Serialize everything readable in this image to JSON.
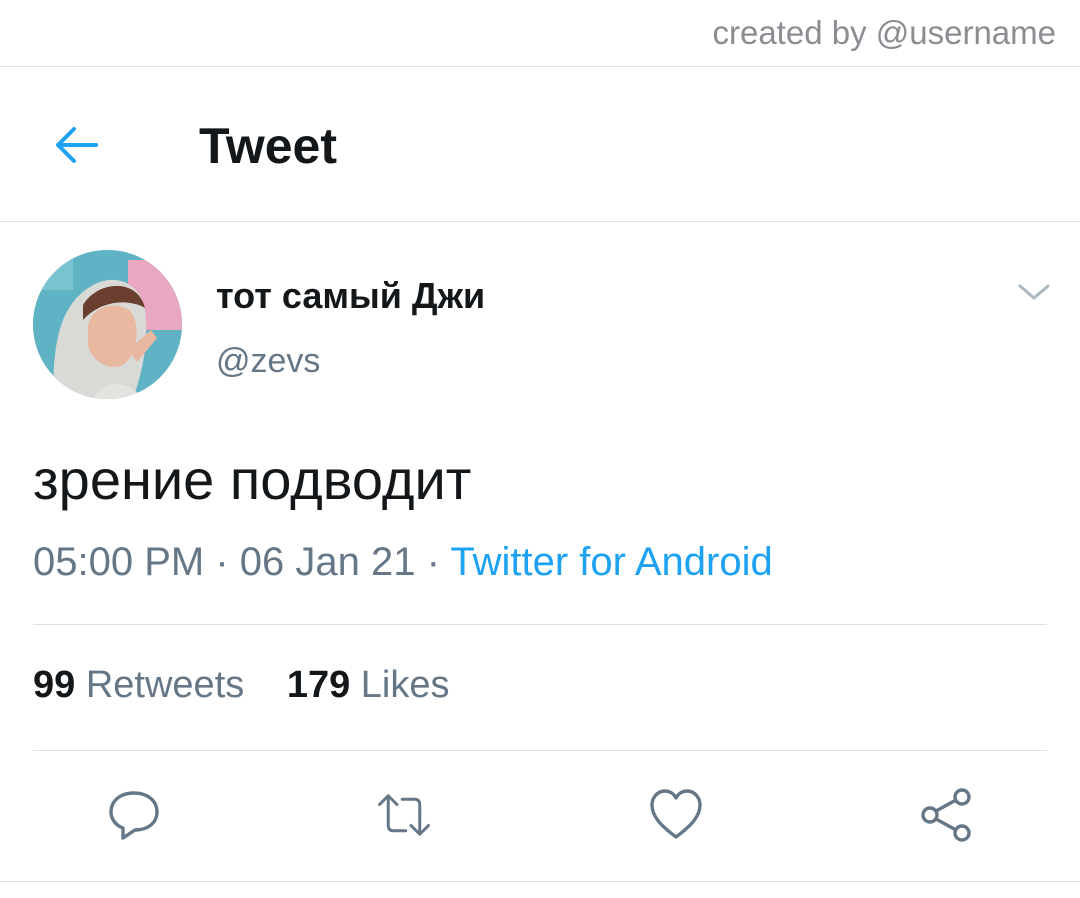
{
  "credit": {
    "text": "created by @username"
  },
  "header": {
    "title": "Tweet",
    "back_icon": "arrow-left-icon"
  },
  "tweet": {
    "author": {
      "display_name": "тот самый Джи",
      "handle": "@zevs"
    },
    "text": "зрение подводит",
    "meta": {
      "time": "05:00 PM",
      "separator": "·",
      "date": "06 Jan 21",
      "source": "Twitter for Android"
    },
    "stats": {
      "retweets_count": "99",
      "retweets_label": "Retweets",
      "likes_count": "179",
      "likes_label": "Likes"
    },
    "actions": [
      "reply-icon",
      "retweet-icon",
      "like-icon",
      "share-icon"
    ]
  },
  "colors": {
    "accent": "#1da1f2",
    "text_primary": "#14171a",
    "text_secondary": "#657786",
    "divider": "#dcdfe2"
  }
}
